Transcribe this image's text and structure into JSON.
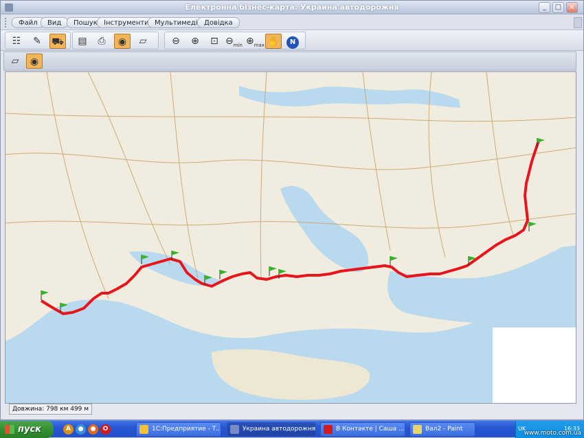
{
  "window": {
    "title": "Електронна бізнес-карта. Украина автодорожня"
  },
  "menu": {
    "items": [
      "Файл",
      "Вид",
      "Пошук",
      "Інструменти",
      "Мультимедіа",
      "Довідка"
    ]
  },
  "toolbar": {
    "zoom_min_label": "min",
    "zoom_max_label": "max",
    "north_label": "N"
  },
  "map": {
    "route_length_label": "Довжина: 798 км 499 м",
    "route_color": "#e8141b",
    "sea_color": "#b9d9ee",
    "land_color": "#f1ece0"
  },
  "taskbar": {
    "start_label": "пуск",
    "tasks": [
      "1С:Предприятие - Т...",
      "Украина автодорожня",
      "В Контакте | Саша ...",
      "Вал2 - Paint"
    ],
    "tray_lang": "UK",
    "clock": "16:33"
  },
  "watermark": "www.moto.com.ua"
}
